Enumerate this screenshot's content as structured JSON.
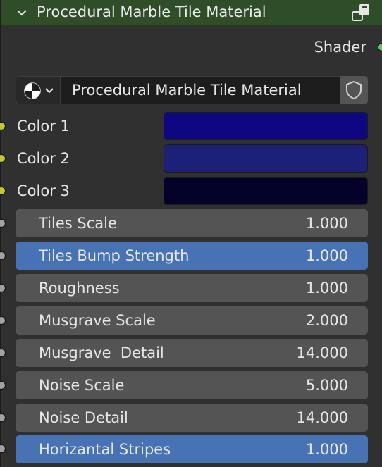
{
  "node": {
    "title": "Procedural Marble Tile Material",
    "header_color": "#2f4d29",
    "output_label": "Shader"
  },
  "material": {
    "name": "Procedural Marble Tile Material"
  },
  "colors": [
    {
      "label": "Color 1",
      "swatch": "#0f0682"
    },
    {
      "label": "Color 2",
      "swatch": "#1c2077"
    },
    {
      "label": "Color 3",
      "swatch": "#05022a"
    }
  ],
  "fields": [
    {
      "label": "Tiles Scale",
      "value": "1.000",
      "active": false
    },
    {
      "label": "Tiles Bump Strength",
      "value": "1.000",
      "active": true
    },
    {
      "label": "Roughness",
      "value": "1.000",
      "active": false
    },
    {
      "label": "Musgrave Scale",
      "value": "2.000",
      "active": false
    },
    {
      "label": "Musgrave  Detail",
      "value": "14.000",
      "active": false
    },
    {
      "label": "Noise Scale",
      "value": "5.000",
      "active": false
    },
    {
      "label": "Noise Detail",
      "value": "14.000",
      "active": false
    },
    {
      "label": "Horizantal Stripes",
      "value": "1.000",
      "active": true
    }
  ],
  "icons": {
    "collapse": "chevron-down-icon",
    "node_type": "node-group-icon",
    "material_preview": "material-sphere-icon",
    "dropdown": "chevron-down-icon",
    "fake_user": "shield-icon"
  },
  "socket_colors": {
    "shader": "#63c763",
    "color": "#c7c729",
    "float": "#a1a1a1"
  },
  "accent": "#4772b3"
}
